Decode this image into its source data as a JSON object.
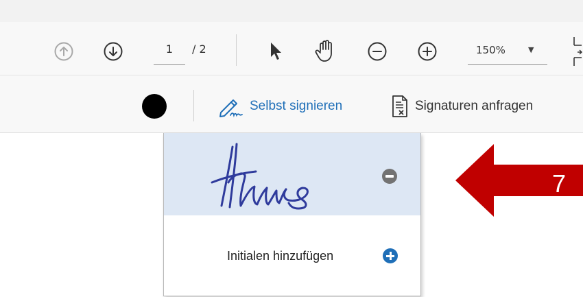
{
  "toolbar": {
    "page_current": "1",
    "page_total": "/ 2",
    "zoom": "150%",
    "zoom_caret": "▼",
    "icons": [
      "arrow-up-circle-icon",
      "arrow-down-circle-icon",
      "select-pointer-icon",
      "hand-icon",
      "zoom-out-icon",
      "zoom-in-icon",
      "fit-page-icon"
    ]
  },
  "sign_bar": {
    "color": "#000000",
    "self_sign_label": "Selbst signieren",
    "request_label": "Signaturen anfragen"
  },
  "dropdown": {
    "signature_text": "Hans",
    "add_initials_label": "Initialen hinzufügen"
  },
  "annotation": {
    "step_number": "7",
    "arrow_color": "#c00000"
  },
  "colors": {
    "accent": "#1f6fb8",
    "signature_ink": "#2f3b9c",
    "selected_row": "#dde7f4"
  }
}
